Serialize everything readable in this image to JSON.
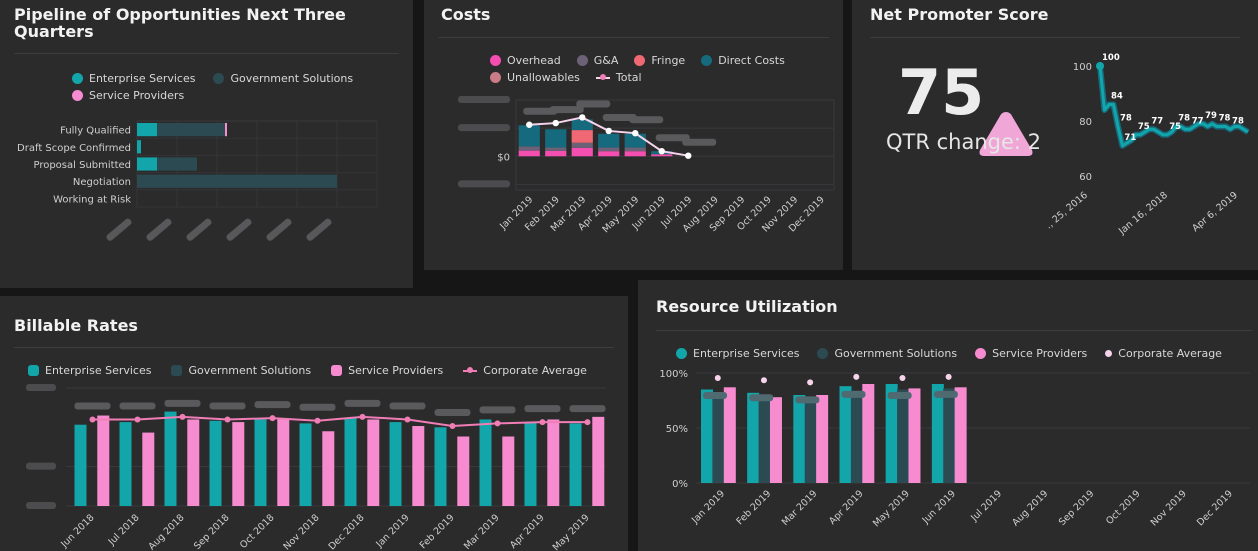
{
  "panels": {
    "pipeline": {
      "title": "Pipeline of Opportunities Next Three Quarters"
    },
    "costs": {
      "title": "Costs"
    },
    "nps": {
      "title": "Net Promoter Score",
      "value": "75",
      "qtr_change": "QTR change: 2"
    },
    "billable": {
      "title": "Billable Rates"
    },
    "resource": {
      "title": "Resource Utilization"
    }
  },
  "colors": {
    "teal": "#12a6ab",
    "dark_slate": "#2c4a52",
    "pink": "#f78bd0",
    "hot_pink": "#f54eb1",
    "purple_gray": "#6d6177",
    "coral": "#f06873",
    "dark_teal": "#156b7d",
    "rose": "#c97b86",
    "indicator": "#f0a6d6"
  },
  "chart_data": [
    {
      "id": "pipeline",
      "type": "bar",
      "orientation": "horizontal",
      "stacked": true,
      "categories": [
        "Fully Qualified",
        "Draft Scope Confirmed",
        "Proposal Submitted",
        "Negotiation",
        "Working at Risk"
      ],
      "series": [
        {
          "name": "Enterprise Services",
          "values": [
            0.5,
            0.1,
            0.5,
            0,
            0
          ]
        },
        {
          "name": "Government Solutions",
          "values": [
            1.7,
            0,
            1.0,
            5.0,
            0
          ]
        },
        {
          "name": "Service Providers",
          "values": [
            0.05,
            0,
            0,
            0,
            0
          ]
        }
      ],
      "xlim": [
        0,
        6
      ],
      "legend": "top"
    },
    {
      "id": "costs",
      "type": "bar",
      "stacked": true,
      "categories": [
        "Jan 2019",
        "Feb 2019",
        "Mar 2019",
        "Apr 2019",
        "May 2019",
        "Jun 2019",
        "Jul 2019",
        "Aug 2019",
        "Sep 2019",
        "Oct 2019",
        "Nov 2019",
        "Dec 2019"
      ],
      "series": [
        {
          "name": "Overhead",
          "values": [
            200,
            190,
            300,
            180,
            180,
            60,
            0,
            0,
            0,
            0,
            0,
            0
          ]
        },
        {
          "name": "G&A",
          "values": [
            150,
            120,
            180,
            130,
            130,
            20,
            0,
            0,
            0,
            0,
            0,
            0
          ]
        },
        {
          "name": "Fringe",
          "values": [
            0,
            0,
            450,
            0,
            0,
            0,
            0,
            0,
            0,
            0,
            0,
            0
          ]
        },
        {
          "name": "Direct Costs",
          "values": [
            750,
            650,
            380,
            490,
            490,
            100,
            0,
            0,
            0,
            0,
            0,
            0
          ]
        },
        {
          "name": "Unallowables",
          "values": [
            0,
            0,
            0,
            0,
            0,
            0,
            0,
            0,
            0,
            0,
            0,
            0
          ]
        }
      ],
      "line": {
        "name": "Total",
        "values": [
          1120,
          1180,
          1380,
          900,
          820,
          180,
          20,
          null,
          null,
          null,
          null,
          null
        ]
      },
      "ylim": [
        -1200,
        2000
      ],
      "legend": "top"
    },
    {
      "id": "nps",
      "type": "line",
      "x_ticks": [
        "., 25, 2016",
        "Jan 16, 2018",
        "Apr 6, 2019"
      ],
      "y_ticks": [
        60,
        80,
        100
      ],
      "ylim": [
        60,
        100
      ],
      "values": [
        100,
        84,
        86,
        86,
        78,
        71,
        72,
        73,
        75,
        75,
        76,
        77,
        77,
        76,
        75,
        75,
        76,
        78,
        78,
        77,
        77,
        78,
        79,
        79,
        78,
        79,
        78,
        78,
        78,
        77,
        78,
        78,
        77,
        76
      ],
      "point_labels": [
        {
          "index": 0,
          "label": "100"
        },
        {
          "index": 2,
          "label": "84"
        },
        {
          "index": 4,
          "label": "78"
        },
        {
          "index": 5,
          "label": "71"
        },
        {
          "index": 8,
          "label": "75"
        },
        {
          "index": 11,
          "label": "77"
        },
        {
          "index": 15,
          "label": "75"
        },
        {
          "index": 17,
          "label": "78"
        },
        {
          "index": 20,
          "label": "77"
        },
        {
          "index": 23,
          "label": "79"
        },
        {
          "index": 26,
          "label": "78"
        },
        {
          "index": 29,
          "label": "78"
        }
      ]
    },
    {
      "id": "billable",
      "type": "bar",
      "categories": [
        "Jun 2018",
        "Jul 2018",
        "Aug 2018",
        "Sep 2018",
        "Oct 2018",
        "Nov 2018",
        "Dec 2018",
        "Jan 2019",
        "Feb 2019",
        "Mar 2019",
        "Apr 2019",
        "May 2019"
      ],
      "series": [
        {
          "name": "Enterprise Services",
          "values": [
            310,
            320,
            360,
            325,
            330,
            315,
            335,
            320,
            300,
            330,
            320,
            315
          ]
        },
        {
          "name": "Government Solutions",
          "values": [
            0,
            0,
            0,
            0,
            0,
            0,
            0,
            0,
            0,
            0,
            0,
            0
          ]
        },
        {
          "name": "Service Providers",
          "values": [
            345,
            280,
            330,
            320,
            335,
            285,
            330,
            305,
            265,
            265,
            330,
            340
          ]
        }
      ],
      "line": {
        "name": "Corporate Average",
        "values": [
          330,
          330,
          340,
          330,
          335,
          325,
          340,
          330,
          305,
          315,
          320,
          320
        ]
      },
      "ylim": [
        0,
        450
      ],
      "legend": "top"
    },
    {
      "id": "resource",
      "type": "bar",
      "categories": [
        "Jan 2019",
        "Feb 2019",
        "Mar 2019",
        "Apr 2019",
        "May 2019",
        "Jun 2019",
        "Jul 2019",
        "Aug 2019",
        "Sep 2019",
        "Oct 2019",
        "Nov 2019",
        "Dec 2019"
      ],
      "y_ticks": [
        "100%",
        "50%",
        "0%"
      ],
      "series": [
        {
          "name": "Enterprise Services",
          "values": [
            85,
            82,
            80,
            88,
            90,
            90,
            null,
            null,
            null,
            null,
            null,
            null
          ]
        },
        {
          "name": "Government Solutions",
          "values": [
            82,
            80,
            78,
            84,
            85,
            86,
            null,
            null,
            null,
            null,
            null,
            null
          ]
        },
        {
          "name": "Service Providers",
          "values": [
            87,
            78,
            80,
            90,
            86,
            87,
            null,
            null,
            null,
            null,
            null,
            null
          ]
        }
      ],
      "points": {
        "name": "Corporate Average",
        "values": [
          90,
          88,
          86,
          91,
          90,
          91,
          null,
          null,
          null,
          null,
          null,
          null
        ]
      },
      "ylim": [
        0,
        100
      ],
      "legend": "top"
    }
  ]
}
